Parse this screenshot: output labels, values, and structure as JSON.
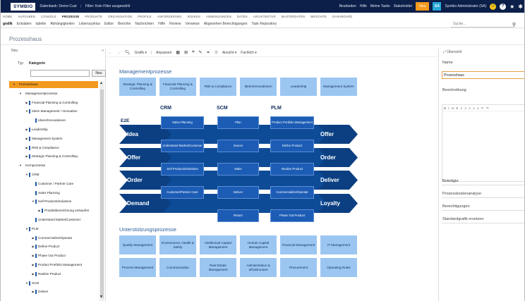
{
  "app": {
    "logo": "SYMBIO",
    "links": [
      "Datenbank: Demo-Cust",
      "Filter: Kein Filter ausgewählt"
    ],
    "right_links": [
      "Bearbeiten",
      "Hilfe",
      "Meine Tasks"
    ],
    "special_label": "Stakeholder",
    "orange_button": "Neu",
    "user_badge": "SA",
    "user_name": "Symbio Administrator (SA)",
    "icons": [
      "smile-icon",
      "help-icon",
      "star-icon",
      "settings-icon"
    ]
  },
  "nav": {
    "row1": [
      "HOME",
      "AUFGABEN",
      "CONSOLE",
      "PROZESSE",
      "PRODUKTE",
      "ORGANISATION",
      "PROFILE",
      "ANFORDERUNG",
      "RISIKEN",
      "ANWENDUNGEN",
      "DATEN",
      "ARCHITEKTUR",
      "MASTERDATEN",
      "BERICHTE",
      "DASHBOARD"
    ],
    "row1_active": "PROZESSE",
    "row2": [
      "grafik",
      "Eckdaten",
      "tabelle",
      "Abhängigkeiten",
      "Lebenszyklus",
      "Editor",
      "Berichte",
      "Nachrichten",
      "Hilfe",
      "Review",
      "Verweise",
      "Abgesehen Berechtigungen",
      "Task Repository"
    ],
    "row2_active": "grafik",
    "search_placeholder": "Suche..."
  },
  "page": {
    "title": "Prozesshaus"
  },
  "left": {
    "header_left": "Neu",
    "header_right": "Kategorie",
    "filter_type_label": "Typ",
    "filter_category_label": "Kategorie",
    "new_button": "Neu",
    "tree": [
      {
        "label": "Prozesshaus",
        "level": 0,
        "twisty": "▼",
        "marker": false,
        "selected": true
      },
      {
        "label": "Managementprozesse",
        "level": 1,
        "twisty": "▼",
        "marker": false
      },
      {
        "label": "Financial Planning & Controlling",
        "level": 2,
        "twisty": "▶",
        "marker": true
      },
      {
        "label": "Ideen Management / Innovation",
        "level": 2,
        "twisty": "▼",
        "marker": true
      },
      {
        "label": "Ideen/Innovationen",
        "level": 3,
        "twisty": "",
        "marker": true
      },
      {
        "label": "Leadership",
        "level": 2,
        "twisty": "▶",
        "marker": true
      },
      {
        "label": "Management System",
        "level": 2,
        "twisty": "▶",
        "marker": true
      },
      {
        "label": "Risk & Compliance",
        "level": 2,
        "twisty": "▶",
        "marker": true
      },
      {
        "label": "Strategic Planning & Controlling",
        "level": 2,
        "twisty": "▶",
        "marker": true
      },
      {
        "label": "Kernprozesse",
        "level": 1,
        "twisty": "▼",
        "marker": false
      },
      {
        "label": "CRM",
        "level": 2,
        "twisty": "▼",
        "marker": true
      },
      {
        "label": "Customer / Partner Care",
        "level": 3,
        "twisty": "",
        "marker": true
      },
      {
        "label": "Sales Planning",
        "level": 3,
        "twisty": "",
        "marker": true
      },
      {
        "label": "Sell Products/Solutions",
        "level": 3,
        "twisty": "▼",
        "marker": true
      },
      {
        "label": "Produktbezeichnung verkaufen",
        "level": 4,
        "twisty": "▶",
        "marker": true
      },
      {
        "label": "Understand Market/Customer",
        "level": 3,
        "twisty": "",
        "marker": true
      },
      {
        "label": "PLM",
        "level": 2,
        "twisty": "▼",
        "marker": true
      },
      {
        "label": "Commercialize/Operate",
        "level": 3,
        "twisty": "▶",
        "marker": true
      },
      {
        "label": "Define Product",
        "level": 3,
        "twisty": "▶",
        "marker": true
      },
      {
        "label": "Phase Out Product",
        "level": 3,
        "twisty": "▶",
        "marker": true
      },
      {
        "label": "Product Portfolio Management",
        "level": 3,
        "twisty": "▶",
        "marker": true
      },
      {
        "label": "Realize Product",
        "level": 3,
        "twisty": "▶",
        "marker": true
      },
      {
        "label": "SCM",
        "level": 2,
        "twisty": "▼",
        "marker": true
      },
      {
        "label": "Deliver",
        "level": 3,
        "twisty": "▶",
        "marker": true
      }
    ]
  },
  "toolbar": {
    "items": [
      "Grafik ▾",
      "Anpassen",
      "Ansicht ▾",
      "Fachlich ▾"
    ]
  },
  "diagram": {
    "management_title": "Managementprozesse",
    "management": [
      "Strategic Planning & Controlling",
      "Financial Planning & Controlling",
      "Risk & Compliance",
      "Ideen/Innovationen",
      "Leadership",
      "Management System"
    ],
    "columns": [
      "CRM",
      "SCM",
      "PLM"
    ],
    "e2e_label": "E2E",
    "rows": [
      {
        "left": "Idea",
        "right": "Offer"
      },
      {
        "left": "Offer",
        "right": "Order"
      },
      {
        "left": "Order",
        "right": "Deliver"
      },
      {
        "left": "Demand",
        "right": "Loyalty"
      }
    ],
    "crm": [
      "Sales Planning",
      "Understand Market/Customer",
      "Sell Products/Solutions",
      "Customer/Partner Care"
    ],
    "scm": [
      "Plan",
      "Source",
      "Make",
      "Deliver",
      "Return"
    ],
    "plm": [
      "Product Portfolio Management",
      "Define Product",
      "Realize Product",
      "Commercialize/Operate",
      "Phase Out Product"
    ],
    "support_title": "Unterstützungsprozesse",
    "support_row1": [
      "Quality Management",
      "Environment, Health & Safety",
      "Intellectual Capital Management",
      "Human Capital Management",
      "Financial Management",
      "IT Management"
    ],
    "support_row2": [
      "Process Management",
      "Communication",
      "Real Estate Management",
      "Administration & Infrastructure",
      "Procurement",
      "Operating Rules"
    ],
    "colors": {
      "box": "#9cc6f2",
      "arrow": "#0b3f82",
      "inner": "#1c5cb5"
    }
  },
  "right": {
    "header": "Übersicht",
    "name_label": "Name",
    "name_value": "Prozesshaus",
    "desc_label": "Beschreibung",
    "editor_toolbar": "B I U S ≡ ≡ ≡ ≡ 𝑥 ↶ ↷",
    "fields": [
      "Beteiligte",
      "Prozesskostenanalyse",
      "Berechtigungen",
      "Standardgrafik ersetzen"
    ]
  }
}
